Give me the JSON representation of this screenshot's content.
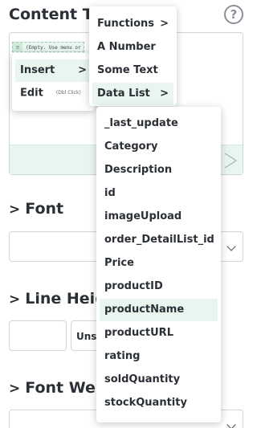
{
  "panel": {
    "title": "Content Text",
    "help_label": "?",
    "editor_placeholder": "(Empty. Use menu or",
    "sections": [
      {
        "label": "Font"
      },
      {
        "label": "Line Height"
      },
      {
        "label": "Font Weight"
      }
    ],
    "unit_value": "Unset"
  },
  "context_menu": {
    "items": [
      {
        "label": "Insert",
        "has_submenu": true,
        "active": true
      },
      {
        "label": "Edit",
        "hint": "(Dbl Click)",
        "has_submenu": false,
        "active": false
      }
    ]
  },
  "insert_menu": {
    "items": [
      {
        "label": "Functions",
        "has_submenu": true,
        "active": false
      },
      {
        "label": "A Number",
        "has_submenu": false,
        "active": false
      },
      {
        "label": "Some Text",
        "has_submenu": false,
        "active": false
      },
      {
        "label": "Data List",
        "has_submenu": true,
        "active": true
      }
    ]
  },
  "data_list_menu": {
    "items": [
      {
        "label": "_last_update"
      },
      {
        "label": "Category"
      },
      {
        "label": "Description"
      },
      {
        "label": "id"
      },
      {
        "label": "imageUpload"
      },
      {
        "label": "order_DetailList_id"
      },
      {
        "label": "Price"
      },
      {
        "label": "productID"
      },
      {
        "label": "productName",
        "active": true
      },
      {
        "label": "productURL"
      },
      {
        "label": "rating"
      },
      {
        "label": "soldQuantity"
      },
      {
        "label": "stockQuantity"
      }
    ]
  },
  "icons": {
    "submenu_arrow": ">",
    "section_chevron": ">",
    "grip": "≡"
  }
}
